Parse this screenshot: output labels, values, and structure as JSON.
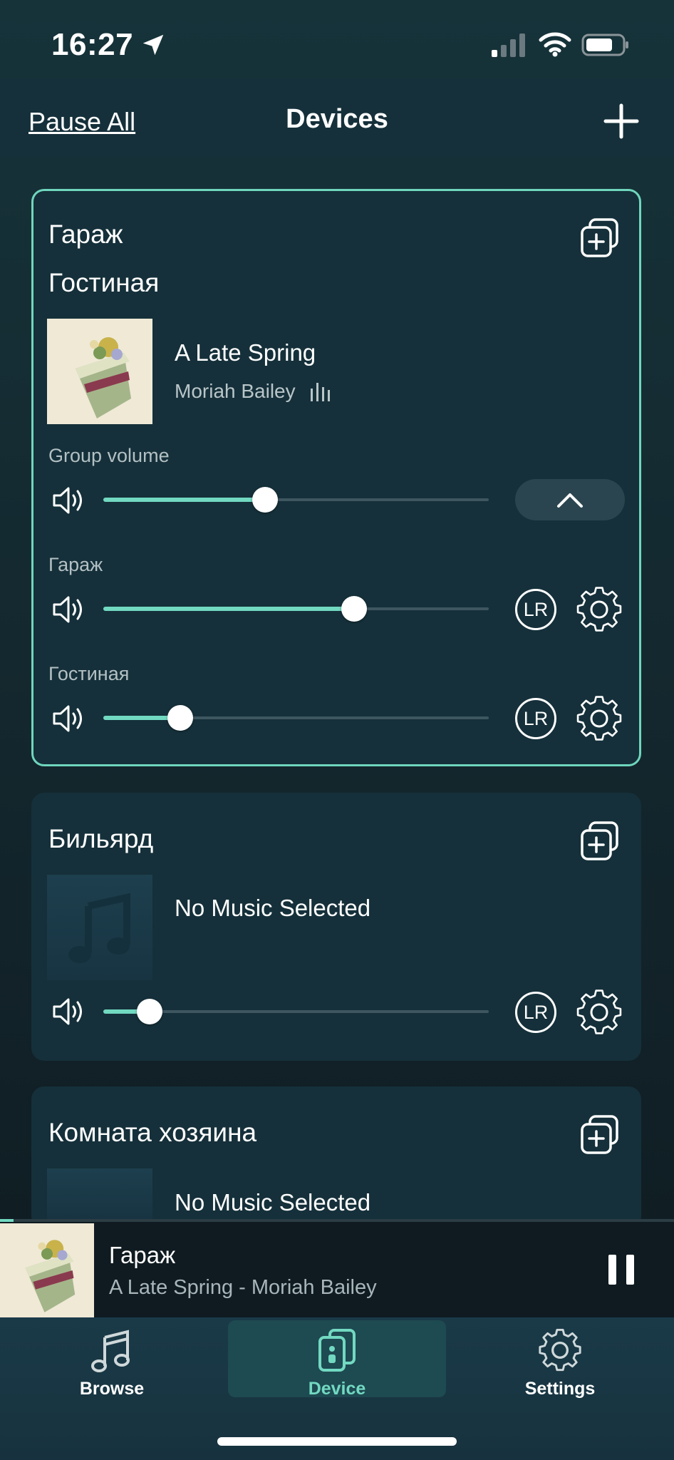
{
  "status_bar": {
    "time": "16:27"
  },
  "header": {
    "pause_all_label": "Pause All",
    "title": "Devices"
  },
  "group_card": {
    "rooms": [
      "Гараж",
      "Гостиная"
    ],
    "track_title": "A Late Spring",
    "track_artist": "Moriah Bailey",
    "group_volume_label": "Group volume",
    "group_volume": 0.42,
    "members": [
      {
        "name": "Гараж",
        "volume": 0.65,
        "lr_label": "LR"
      },
      {
        "name": "Гостиная",
        "volume": 0.2,
        "lr_label": "LR"
      }
    ]
  },
  "billiard_card": {
    "room": "Бильярд",
    "no_music_label": "No Music Selected",
    "volume": 0.12,
    "lr_label": "LR"
  },
  "master_card": {
    "room": "Комната хозяина",
    "no_music_label": "No Music Selected"
  },
  "now_playing": {
    "room": "Гараж",
    "track": "A Late Spring - Moriah Bailey",
    "progress": 0.02
  },
  "tabs": [
    {
      "label": "Browse",
      "icon": "music-note-icon",
      "active": false
    },
    {
      "label": "Device",
      "icon": "speaker-icon",
      "active": true
    },
    {
      "label": "Settings",
      "icon": "gear-icon",
      "active": false
    }
  ],
  "colors": {
    "accent": "#72d9c1",
    "card_border": "#6fd6bd",
    "background": "#15303a"
  }
}
